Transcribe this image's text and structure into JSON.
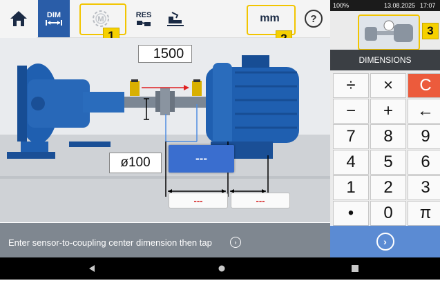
{
  "toolbar": {
    "dim_label": "DIM",
    "measure_label": "M",
    "res_label": "RES",
    "units_value": "mm",
    "help_symbol": "?"
  },
  "badges": [
    "1",
    "2",
    "3"
  ],
  "scene": {
    "rpm_value": "1500",
    "diameter_value": "ø100",
    "center_value": "---",
    "dim1_value": "---",
    "dim2_value": "---"
  },
  "status_bar": {
    "battery": "100%",
    "date": "13.08.2025",
    "time": "17:07"
  },
  "panel": {
    "title": "DIMENSIONS"
  },
  "keypad": [
    [
      "÷",
      "×",
      "C"
    ],
    [
      "−",
      "+",
      "←"
    ],
    [
      "7",
      "8",
      "9"
    ],
    [
      "4",
      "5",
      "6"
    ],
    [
      "1",
      "2",
      "3"
    ],
    [
      "•",
      "0",
      "π"
    ]
  ],
  "instruction": {
    "text": "Enter sensor-to-coupling center dimension then tap"
  },
  "colors": {
    "accent_blue": "#2a5da8",
    "highlight_yellow": "#f5d000",
    "clear_key": "#ec5b3c",
    "instruction_bar": "#7f8790",
    "go_button": "#5b8bd3",
    "pump_blue": "#1f5fb0"
  },
  "icons": [
    "home-icon",
    "machine-train-icon",
    "dimension-icon",
    "measure-icon",
    "results-icon",
    "align-icon",
    "help-icon",
    "next-icon",
    "android-back-icon",
    "android-home-icon",
    "android-recent-icon"
  ]
}
